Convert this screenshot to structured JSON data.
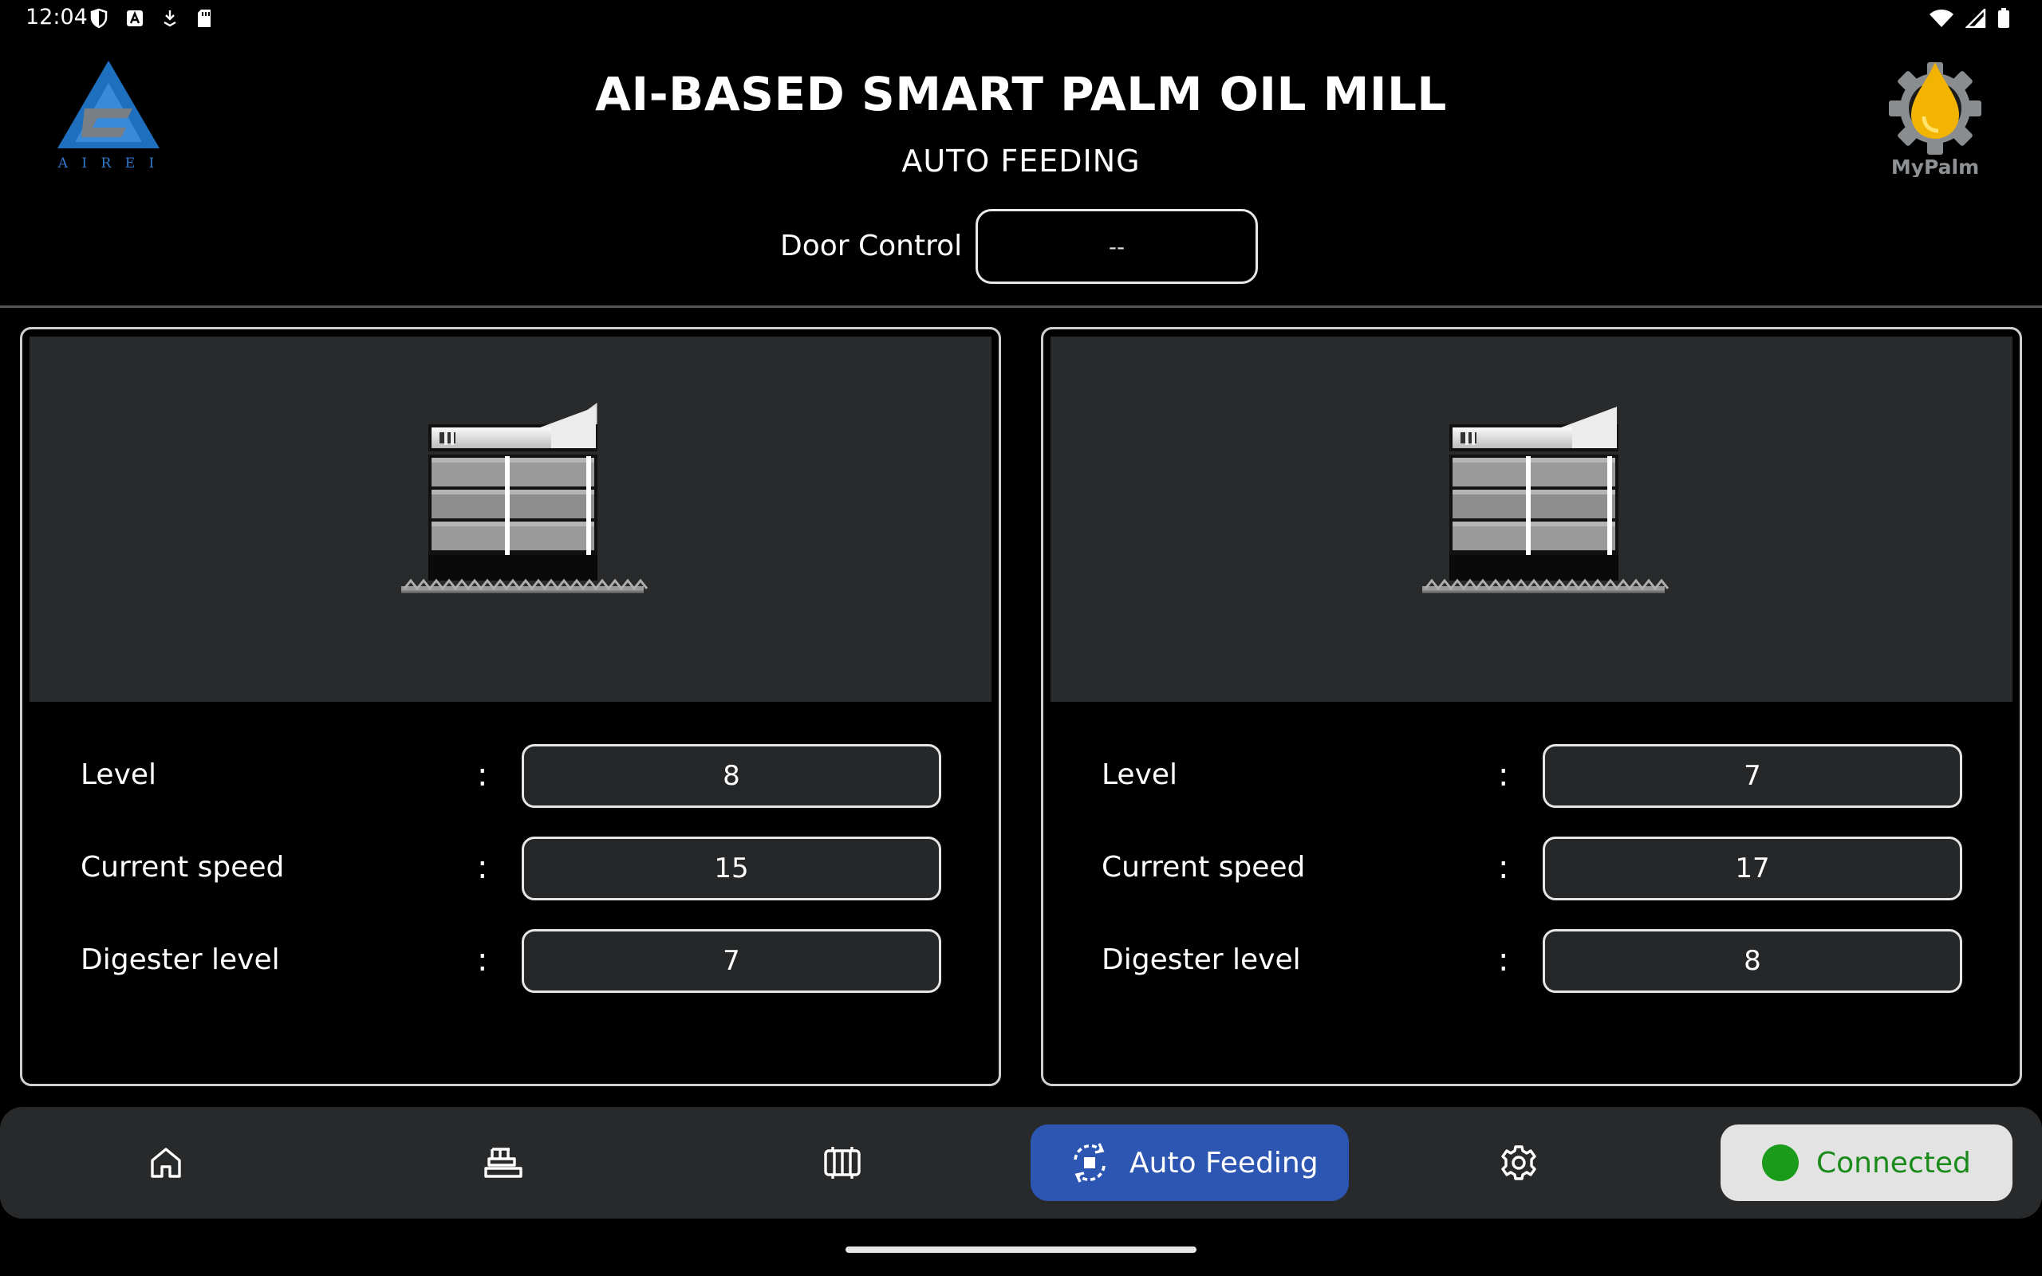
{
  "status_bar": {
    "time": "12:04",
    "left_icons": [
      "shield-icon",
      "a-badge-icon",
      "download-icon",
      "sd-card-icon"
    ],
    "right_icons": [
      "wifi-icon",
      "signal-icon",
      "battery-icon"
    ]
  },
  "header": {
    "logo_left_text": "A I R E I",
    "title": "AI-BASED SMART PALM OIL MILL",
    "subtitle": "AUTO FEEDING",
    "logo_right_text": "MyPalm"
  },
  "door_control": {
    "label": "Door Control",
    "value": "--"
  },
  "panels": [
    {
      "rows": [
        {
          "label": "Level",
          "colon": ":",
          "value": "8"
        },
        {
          "label": "Current speed",
          "colon": ":",
          "value": "15"
        },
        {
          "label": "Digester level",
          "colon": ":",
          "value": "7"
        }
      ]
    },
    {
      "rows": [
        {
          "label": "Level",
          "colon": ":",
          "value": "7"
        },
        {
          "label": "Current speed",
          "colon": ":",
          "value": "17"
        },
        {
          "label": "Digester level",
          "colon": ":",
          "value": "8"
        }
      ]
    }
  ],
  "bottom_nav": {
    "items": [
      {
        "icon": "home-icon"
      },
      {
        "icon": "scale-icon"
      },
      {
        "icon": "machine-icon"
      },
      {
        "icon": "auto-feeding-icon",
        "label": "Auto Feeding",
        "active": true
      },
      {
        "icon": "gear-icon"
      }
    ],
    "connection": {
      "label": "Connected",
      "color": "#1a9b1a"
    }
  },
  "colors": {
    "accent": "#2d56b3",
    "panel_bg": "#292a2b",
    "connected": "#1a9b1a"
  }
}
